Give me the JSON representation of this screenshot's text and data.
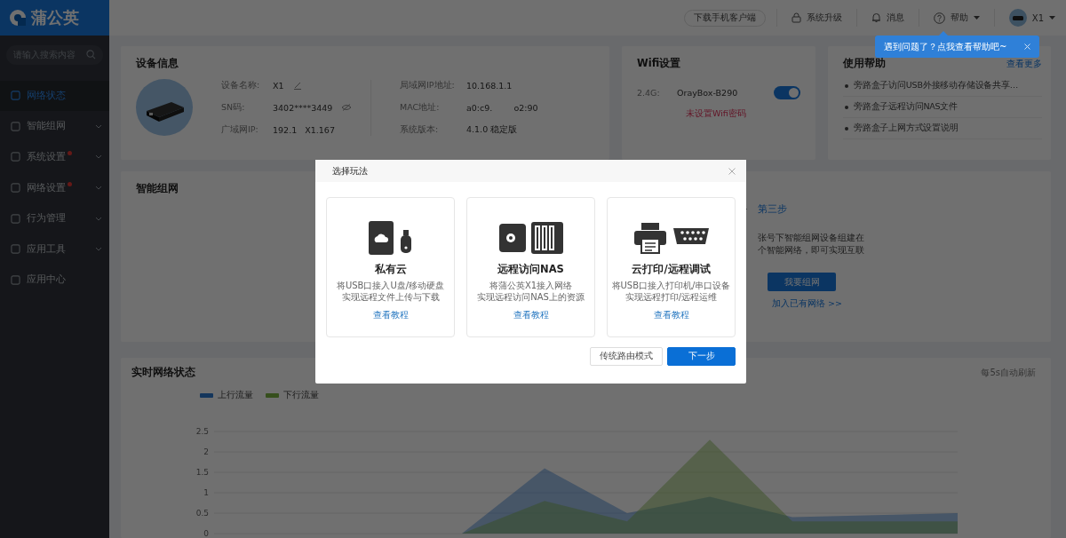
{
  "sidebar": {
    "logo": "蒲公英",
    "search": {
      "placeholder": "请输入搜索内容"
    },
    "items": [
      {
        "label": "网络状态",
        "selected": true,
        "submenu": false,
        "badge": false
      },
      {
        "label": "智能组网",
        "selected": false,
        "submenu": true,
        "badge": false
      },
      {
        "label": "系统设置",
        "selected": false,
        "submenu": true,
        "badge": true
      },
      {
        "label": "网络设置",
        "selected": false,
        "submenu": true,
        "badge": true
      },
      {
        "label": "行为管理",
        "selected": false,
        "submenu": true,
        "badge": false
      },
      {
        "label": "应用工具",
        "selected": false,
        "submenu": true,
        "badge": false
      },
      {
        "label": "应用中心",
        "selected": false,
        "submenu": false,
        "badge": false
      }
    ]
  },
  "header": {
    "download_button": "下载手机客户端",
    "actions": [
      {
        "kind": "upgrade",
        "label": "系统升级",
        "caret": false
      },
      {
        "kind": "message",
        "label": "消息",
        "caret": false
      },
      {
        "kind": "help",
        "label": "帮助",
        "caret": true
      }
    ],
    "user": "X1",
    "tooltip": "遇到问题了？点我查看帮助吧~"
  },
  "device_info": {
    "title": "设备信息",
    "left": [
      {
        "label": "设备名称:",
        "value": "X1",
        "kind": "edit"
      },
      {
        "label": "SN码:",
        "value": "3402****3449",
        "kind": "hide"
      },
      {
        "label": "广域网IP:",
        "value": "192.1   X1.167",
        "kind": "plain"
      }
    ],
    "right": [
      {
        "label": "局域网IP地址:",
        "value": "10.168.1.1"
      },
      {
        "label": "MAC地址:",
        "value": "a0:c9.        o2:90"
      },
      {
        "label": "系统版本:",
        "value": "4.1.0 稳定版"
      }
    ]
  },
  "wifi": {
    "title": "Wifi设置",
    "band": "2.4G:",
    "ssid": "OrayBox-B290",
    "on": true,
    "warning": "未设置Wifi密码"
  },
  "help": {
    "title": "使用帮助",
    "more": "查看更多",
    "links": [
      "旁路盒子访问USB外接移动存储设备共享…",
      "旁路盒子远程访问NAS文件",
      "旁路盒子上网方式设置说明"
    ]
  },
  "smart_network": {
    "title": "智能组网",
    "step": "第三步",
    "desc": [
      "张号下智能组网设备组建在",
      "个智能网络，即可实现互联"
    ],
    "button": "我要组网",
    "link": "加入已有网络 >>"
  },
  "realtime": {
    "title": "实时网络状态",
    "note": "每5s自动刷新",
    "chart_data": {
      "type": "area",
      "grid": true,
      "yticks": [
        0,
        0.5,
        1,
        1.5,
        2,
        2.5
      ],
      "ylim": [
        0,
        2.5
      ],
      "series": [
        {
          "name": "上行流量",
          "color": "#2f7bd1",
          "values": [
            0,
            0,
            0,
            0,
            1.6,
            0.5,
            0.9,
            0.4,
            0.45,
            0.5
          ]
        },
        {
          "name": "下行流量",
          "color": "#7cb342",
          "values": [
            0,
            0,
            0,
            0,
            0.8,
            0.3,
            2.3,
            0.3,
            0.3,
            0.3
          ]
        }
      ]
    }
  },
  "modal": {
    "title": "选择玩法",
    "options": [
      {
        "kind": "cloud",
        "title": "私有云",
        "desc": [
          "将USB口接入U盘/移动硬盘",
          "实现远程文件上传与下载"
        ],
        "link": "查看教程"
      },
      {
        "kind": "nas",
        "title": "远程访问NAS",
        "desc": [
          "将蒲公英X1接入网络",
          "实现远程访问NAS上的资源"
        ],
        "link": "查看教程"
      },
      {
        "kind": "print",
        "title": "云打印/远程调试",
        "desc": [
          "将USB口接入打印机/串口设备",
          "实现远程打印/远程运维"
        ],
        "link": "查看教程"
      }
    ],
    "buttons": [
      {
        "label": "传统路由模式",
        "primary": false
      },
      {
        "label": "下一步",
        "primary": true
      }
    ]
  }
}
